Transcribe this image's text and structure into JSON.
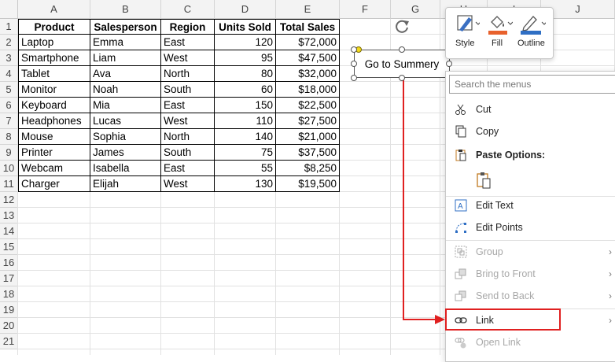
{
  "columns": [
    "A",
    "B",
    "C",
    "D",
    "E",
    "F",
    "G",
    "H",
    "I",
    "J"
  ],
  "rows": [
    "1",
    "2",
    "3",
    "4",
    "5",
    "6",
    "7",
    "8",
    "9",
    "10",
    "11",
    "12",
    "13",
    "14",
    "15",
    "16",
    "17",
    "18",
    "19",
    "20",
    "21"
  ],
  "table": {
    "headers": [
      "Product",
      "Salesperson",
      "Region",
      "Units Sold",
      "Total Sales"
    ],
    "rows": [
      [
        "Laptop",
        "Emma",
        "East",
        "120",
        "$72,000"
      ],
      [
        "Smartphone",
        "Liam",
        "West",
        "95",
        "$47,500"
      ],
      [
        "Tablet",
        "Ava",
        "North",
        "80",
        "$32,000"
      ],
      [
        "Monitor",
        "Noah",
        "South",
        "60",
        "$18,000"
      ],
      [
        "Keyboard",
        "Mia",
        "East",
        "150",
        "$22,500"
      ],
      [
        "Headphones",
        "Lucas",
        "West",
        "110",
        "$27,500"
      ],
      [
        "Mouse",
        "Sophia",
        "North",
        "140",
        "$21,000"
      ],
      [
        "Printer",
        "James",
        "South",
        "75",
        "$37,500"
      ],
      [
        "Webcam",
        "Isabella",
        "East",
        "55",
        "$8,250"
      ],
      [
        "Charger",
        "Elijah",
        "West",
        "130",
        "$19,500"
      ]
    ]
  },
  "shape": {
    "text": "Go to Summery"
  },
  "mini_toolbar": {
    "style": "Style",
    "fill": "Fill",
    "outline": "Outline",
    "fill_color": "#e8612c",
    "outline_color": "#2f6fc4"
  },
  "context_menu": {
    "search_placeholder": "Search the menus",
    "cut": "Cut",
    "copy": "Copy",
    "paste_options": "Paste Options:",
    "edit_text": "Edit Text",
    "edit_points": "Edit Points",
    "group": "Group",
    "bring_to_front": "Bring to Front",
    "send_to_back": "Send to Back",
    "link": "Link",
    "open_link": "Open Link"
  },
  "accent": {
    "annotation": "#e02020",
    "selection": "#555555"
  }
}
